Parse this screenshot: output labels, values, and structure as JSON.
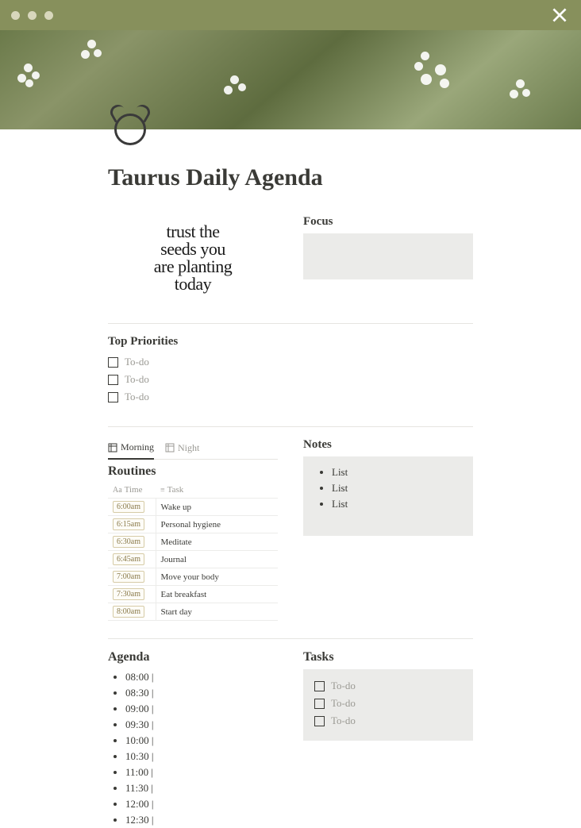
{
  "chrome": {
    "close": "Close"
  },
  "page": {
    "title": "Taurus Daily Agenda",
    "quote_l1": "trust the",
    "quote_l2": "seeds you",
    "quote_l3": "are planting",
    "quote_l4": "today"
  },
  "focus": {
    "label": "Focus"
  },
  "priorities": {
    "label": "Top Priorities",
    "items": [
      "To-do",
      "To-do",
      "To-do"
    ]
  },
  "routines": {
    "tabs": [
      "Morning",
      "Night"
    ],
    "active_tab": 0,
    "heading": "Routines",
    "columns": {
      "time": "Time",
      "task": "Task"
    },
    "rows": [
      {
        "time": "6:00am",
        "task": "Wake up"
      },
      {
        "time": "6:15am",
        "task": "Personal hygiene"
      },
      {
        "time": "6:30am",
        "task": "Meditate"
      },
      {
        "time": "6:45am",
        "task": "Journal"
      },
      {
        "time": "7:00am",
        "task": "Move your body"
      },
      {
        "time": "7:30am",
        "task": "Eat breakfast"
      },
      {
        "time": "8:00am",
        "task": "Start day"
      }
    ]
  },
  "notes": {
    "label": "Notes",
    "items": [
      "List",
      "List",
      "List"
    ]
  },
  "agenda": {
    "label": "Agenda",
    "slots": [
      "08:00 |",
      "08:30 |",
      "09:00 |",
      "09:30 |",
      "10:00 |",
      "10:30 |",
      "11:00 |",
      "11:30 |",
      "12:00 |",
      "12:30 |"
    ]
  },
  "tasks": {
    "label": "Tasks",
    "items": [
      "To-do",
      "To-do",
      "To-do"
    ]
  }
}
